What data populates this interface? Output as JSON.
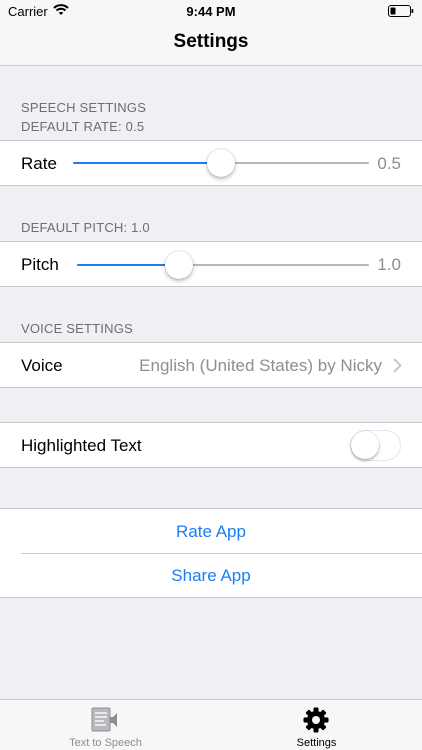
{
  "status_bar": {
    "carrier": "Carrier",
    "time": "9:44 PM"
  },
  "nav": {
    "title": "Settings"
  },
  "speech_settings": {
    "header": "SPEECH SETTINGS",
    "rate_caption": "DEFAULT RATE: 0.5",
    "rate": {
      "label": "Rate",
      "value_text": "0.5",
      "fraction": 0.5
    },
    "pitch_caption": "DEFAULT PITCH: 1.0",
    "pitch": {
      "label": "Pitch",
      "value_text": "1.0",
      "fraction": 0.35
    }
  },
  "voice_settings": {
    "header": "VOICE SETTINGS",
    "voice_label": "Voice",
    "voice_value": "English (United States) by Nicky"
  },
  "highlight": {
    "label": "Highlighted Text",
    "enabled": false
  },
  "links": {
    "rate_app": "Rate App",
    "share_app": "Share App"
  },
  "tab_bar": {
    "tabs": [
      {
        "label": "Text to Speech",
        "icon": "document-speech-icon",
        "active": false
      },
      {
        "label": "Settings",
        "icon": "gear-icon",
        "active": true
      }
    ]
  },
  "colors": {
    "accent": "#1a7ef5",
    "background": "#efeff4",
    "secondary_text": "#8e8e93"
  }
}
